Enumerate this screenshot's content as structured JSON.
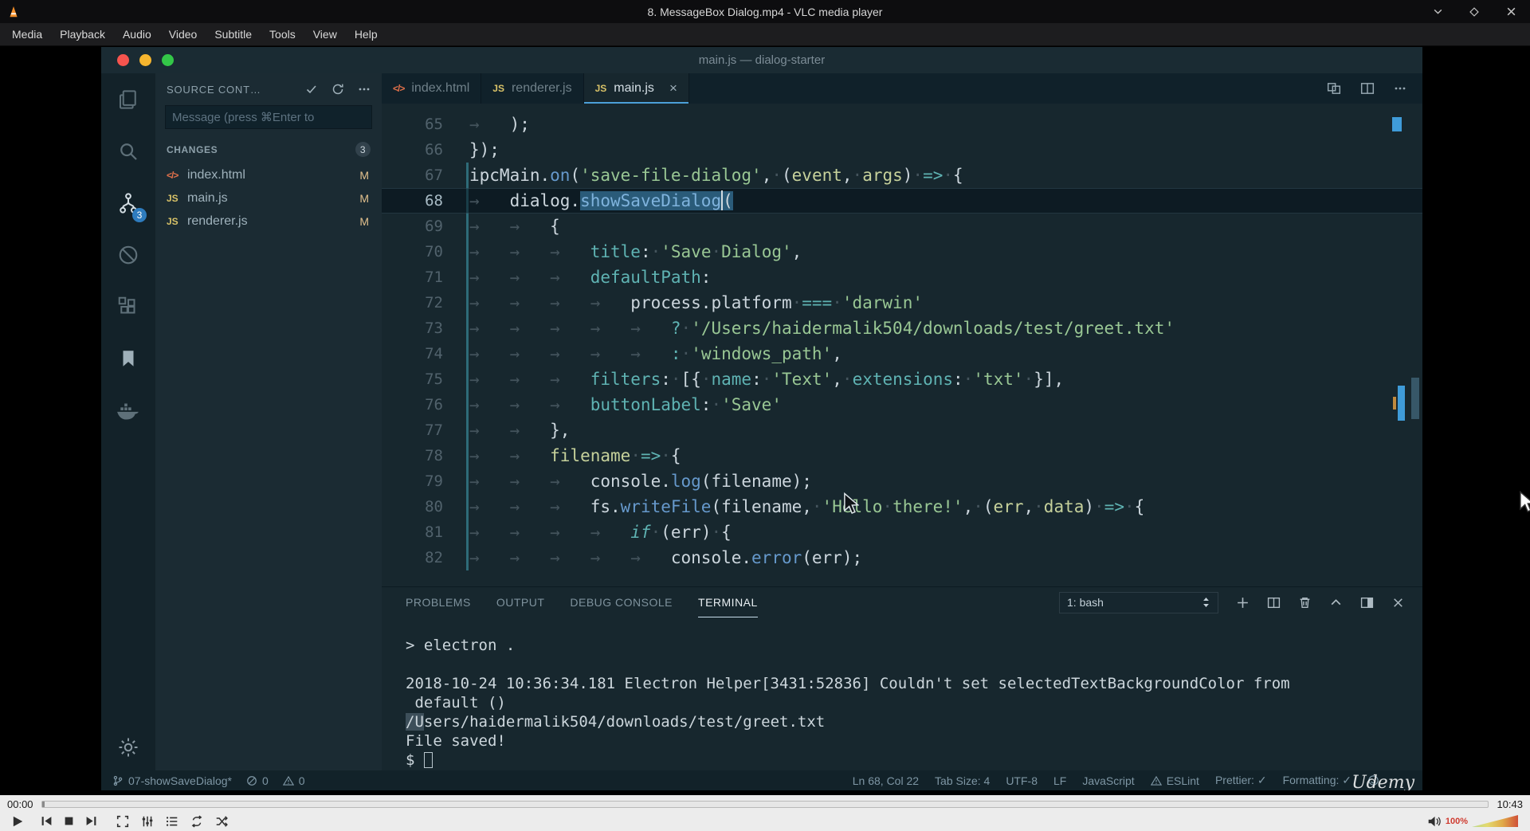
{
  "vlc": {
    "window_title": "8. MessageBox Dialog.mp4 - VLC media player",
    "menu": [
      "Media",
      "Playback",
      "Audio",
      "Video",
      "Subtitle",
      "Tools",
      "View",
      "Help"
    ],
    "seek": {
      "elapsed": "00:00",
      "total": "10:43"
    },
    "volume_label": "100%"
  },
  "vscode": {
    "title": "main.js — dialog-starter",
    "activity": {
      "scm_badge": "3"
    },
    "sidebar": {
      "header": "SOURCE CONT…",
      "message_placeholder": "Message (press ⌘Enter to",
      "changes_label": "CHANGES",
      "changes_count": "3",
      "files": [
        {
          "name": "index.html",
          "icon": "html",
          "badge": "M"
        },
        {
          "name": "main.js",
          "icon": "js",
          "badge": "M"
        },
        {
          "name": "renderer.js",
          "icon": "js",
          "badge": "M"
        }
      ]
    },
    "tabs": [
      {
        "label": "index.html",
        "icon": "html",
        "active": false
      },
      {
        "label": "renderer.js",
        "icon": "js",
        "active": false
      },
      {
        "label": "main.js",
        "icon": "js",
        "active": true
      }
    ],
    "editor": {
      "lines": [
        {
          "n": 65,
          "t": [
            [
              "w",
              "→   "
            ],
            [
              "f",
              ");"
            ]
          ]
        },
        {
          "n": 66,
          "t": [
            [
              "f",
              "});"
            ]
          ]
        },
        {
          "n": 67,
          "t": [
            [
              "f",
              "ipcMain."
            ],
            [
              "b",
              "on"
            ],
            [
              "f",
              "("
            ],
            [
              "g",
              "'save-file-dialog'"
            ],
            [
              "f",
              ","
            ],
            [
              "w",
              "·"
            ],
            [
              "f",
              "("
            ],
            [
              "p",
              "event"
            ],
            [
              "f",
              ","
            ],
            [
              "w",
              "·"
            ],
            [
              "p",
              "args"
            ],
            [
              "f",
              ")"
            ],
            [
              "w",
              "·"
            ],
            [
              "c",
              "=>"
            ],
            [
              "w",
              "·"
            ],
            [
              "f",
              "{"
            ]
          ]
        },
        {
          "n": 68,
          "cur": true,
          "t": [
            [
              "w",
              "→   "
            ],
            [
              "f",
              "dialog."
            ],
            [
              "bs",
              "showSaveDialog"
            ],
            [
              "cr",
              ""
            ],
            [
              "fs",
              "("
            ]
          ]
        },
        {
          "n": 69,
          "t": [
            [
              "w",
              "→   →   "
            ],
            [
              "f",
              "{"
            ]
          ]
        },
        {
          "n": 70,
          "t": [
            [
              "w",
              "→   →   →   "
            ],
            [
              "c",
              "title"
            ],
            [
              "f",
              ":"
            ],
            [
              "w",
              "·"
            ],
            [
              "g",
              "'Save"
            ],
            [
              "w",
              "·"
            ],
            [
              "g",
              "Dialog'"
            ],
            [
              "f",
              ","
            ]
          ]
        },
        {
          "n": 71,
          "t": [
            [
              "w",
              "→   →   →   "
            ],
            [
              "c",
              "defaultPath"
            ],
            [
              "f",
              ":"
            ]
          ]
        },
        {
          "n": 72,
          "t": [
            [
              "w",
              "→   →   →   →   "
            ],
            [
              "f",
              "process.platform"
            ],
            [
              "w",
              "·"
            ],
            [
              "c",
              "==="
            ],
            [
              "w",
              "·"
            ],
            [
              "g",
              "'darwin'"
            ]
          ]
        },
        {
          "n": 73,
          "t": [
            [
              "w",
              "→   →   →   →   →   "
            ],
            [
              "c",
              "?"
            ],
            [
              "w",
              "·"
            ],
            [
              "g",
              "'/Users/haidermalik504/downloads/test/greet.txt'"
            ]
          ]
        },
        {
          "n": 74,
          "t": [
            [
              "w",
              "→   →   →   →   →   "
            ],
            [
              "c",
              ":"
            ],
            [
              "w",
              "·"
            ],
            [
              "g",
              "'windows_path'"
            ],
            [
              "f",
              ","
            ]
          ]
        },
        {
          "n": 75,
          "t": [
            [
              "w",
              "→   →   →   "
            ],
            [
              "c",
              "filters"
            ],
            [
              "f",
              ":"
            ],
            [
              "w",
              "·"
            ],
            [
              "f",
              "[{"
            ],
            [
              "w",
              "·"
            ],
            [
              "c",
              "name"
            ],
            [
              "f",
              ":"
            ],
            [
              "w",
              "·"
            ],
            [
              "g",
              "'Text'"
            ],
            [
              "f",
              ","
            ],
            [
              "w",
              "·"
            ],
            [
              "c",
              "extensions"
            ],
            [
              "f",
              ":"
            ],
            [
              "w",
              "·"
            ],
            [
              "g",
              "'txt'"
            ],
            [
              "w",
              "·"
            ],
            [
              "f",
              "}],"
            ]
          ]
        },
        {
          "n": 76,
          "t": [
            [
              "w",
              "→   →   →   "
            ],
            [
              "c",
              "buttonLabel"
            ],
            [
              "f",
              ":"
            ],
            [
              "w",
              "·"
            ],
            [
              "g",
              "'Save'"
            ]
          ]
        },
        {
          "n": 77,
          "t": [
            [
              "w",
              "→   →   "
            ],
            [
              "f",
              "},"
            ]
          ]
        },
        {
          "n": 78,
          "t": [
            [
              "w",
              "→   →   "
            ],
            [
              "p",
              "filename"
            ],
            [
              "w",
              "·"
            ],
            [
              "c",
              "=>"
            ],
            [
              "w",
              "·"
            ],
            [
              "f",
              "{"
            ]
          ]
        },
        {
          "n": 79,
          "t": [
            [
              "w",
              "→   →   →   "
            ],
            [
              "f",
              "console."
            ],
            [
              "b",
              "log"
            ],
            [
              "f",
              "(filename);"
            ]
          ]
        },
        {
          "n": 80,
          "t": [
            [
              "w",
              "→   →   →   "
            ],
            [
              "f",
              "fs."
            ],
            [
              "b",
              "writeFile"
            ],
            [
              "f",
              "(filename,"
            ],
            [
              "w",
              "·"
            ],
            [
              "g",
              "'Hello"
            ],
            [
              "w",
              "·"
            ],
            [
              "g",
              "there!'"
            ],
            [
              "f",
              ","
            ],
            [
              "w",
              "·"
            ],
            [
              "f",
              "("
            ],
            [
              "p",
              "err"
            ],
            [
              "f",
              ","
            ],
            [
              "w",
              "·"
            ],
            [
              "p",
              "data"
            ],
            [
              "f",
              ")"
            ],
            [
              "w",
              "·"
            ],
            [
              "c",
              "=>"
            ],
            [
              "w",
              "·"
            ],
            [
              "f",
              "{"
            ]
          ]
        },
        {
          "n": 81,
          "t": [
            [
              "w",
              "→   →   →   →   "
            ],
            [
              "k",
              "if"
            ],
            [
              "w",
              "·"
            ],
            [
              "f",
              "(err)"
            ],
            [
              "w",
              "·"
            ],
            [
              "f",
              "{"
            ]
          ]
        },
        {
          "n": 82,
          "t": [
            [
              "w",
              "→   →   →   →   →   "
            ],
            [
              "f",
              "console."
            ],
            [
              "b",
              "error"
            ],
            [
              "f",
              "(err);"
            ]
          ]
        }
      ]
    },
    "panel": {
      "tabs": [
        {
          "label": "PROBLEMS",
          "active": false
        },
        {
          "label": "OUTPUT",
          "active": false
        },
        {
          "label": "DEBUG CONSOLE",
          "active": false
        },
        {
          "label": "TERMINAL",
          "active": true
        }
      ],
      "shell": "1: bash",
      "terminal": [
        [
          [
            "tt",
            "> electron ."
          ]
        ],
        [],
        [
          [
            "tt",
            "2018-10-24 10:36:34.181 Electron Helper[3431:52836] Couldn't set selectedTextBackgroundColor from"
          ]
        ],
        [
          [
            "tt",
            " default ()"
          ]
        ],
        [
          [
            "ts",
            "/U"
          ],
          [
            "tt",
            "sers/haidermalik504/downloads/test/greet.txt"
          ]
        ],
        [
          [
            "tt",
            "File saved!"
          ]
        ],
        [
          [
            "tt",
            "$ "
          ],
          [
            "tc",
            ""
          ]
        ]
      ]
    },
    "status": {
      "left": [
        {
          "icon": "branch",
          "text": "07-showSaveDialog*"
        },
        {
          "icon": "error",
          "text": "0"
        },
        {
          "icon": "warning",
          "text": "0"
        }
      ],
      "right": [
        {
          "text": "Ln 68, Col 22"
        },
        {
          "text": "Tab Size: 4"
        },
        {
          "text": "UTF-8"
        },
        {
          "text": "LF"
        },
        {
          "text": "JavaScript"
        },
        {
          "icon": "warning",
          "text": "ESLint"
        },
        {
          "text": "Prettier: ✓"
        },
        {
          "text": "Formatting: ✓"
        },
        {
          "icon": "smiley",
          "text": ""
        }
      ]
    },
    "watermark": "Udemy"
  },
  "colors": {
    "scm_badge_blue": "#2e7cbe",
    "modified_badge": "#e2c08d",
    "string_green": "#99c794",
    "function_blue": "#6699cc",
    "key_cyan": "#5fb3b3",
    "active_tab_underline": "#4b9fd8",
    "volume_label_red": "#cf3b30",
    "traffic_red": "#f6544e",
    "traffic_yellow": "#f5b52e",
    "traffic_green": "#33c748"
  }
}
